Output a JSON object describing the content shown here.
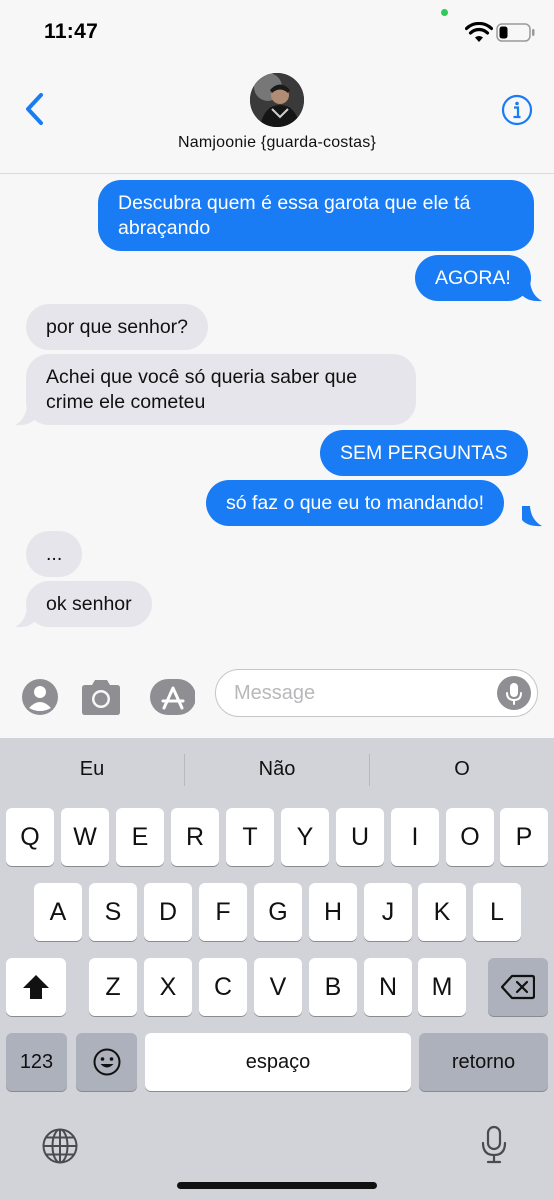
{
  "status_bar": {
    "time": "11:47"
  },
  "header": {
    "contact_name": "Namjoonie {guarda-costas}"
  },
  "messages": [
    {
      "text_lines": [
        "Descubra quem é essa garota que ele tá",
        "abraçando"
      ],
      "from": "me"
    },
    {
      "text_lines": [
        "AGORA!"
      ],
      "from": "me"
    },
    {
      "text_lines": [
        "por que senhor?"
      ],
      "from": "them"
    },
    {
      "text_lines": [
        "Achei que você só queria saber que",
        "crime ele cometeu"
      ],
      "from": "them"
    },
    {
      "text_lines": [
        "SEM PERGUNTAS"
      ],
      "from": "me"
    },
    {
      "text_lines": [
        "só faz o que eu to mandando!"
      ],
      "from": "me"
    },
    {
      "text_lines": [
        "..."
      ],
      "from": "them"
    },
    {
      "text_lines": [
        "ok senhor"
      ],
      "from": "them"
    }
  ],
  "input": {
    "placeholder": "Message"
  },
  "keyboard": {
    "suggestions": [
      "Eu",
      "Não",
      "O"
    ],
    "row1": [
      "Q",
      "W",
      "E",
      "R",
      "T",
      "Y",
      "U",
      "I",
      "O",
      "P"
    ],
    "row2": [
      "A",
      "S",
      "D",
      "F",
      "G",
      "H",
      "J",
      "K",
      "L"
    ],
    "row3": [
      "Z",
      "X",
      "C",
      "V",
      "B",
      "N",
      "M"
    ],
    "numbers_label": "123",
    "space_label": "espaço",
    "return_label": "retorno"
  },
  "colors": {
    "sent_bubble": "#1a7cf5",
    "received_bubble": "#e6e5eb",
    "accent": "#1a7cf5"
  },
  "icons": [
    "back-chevron-icon",
    "info-icon",
    "contact-avatar",
    "wifi-icon",
    "battery-icon",
    "memoji-icon",
    "camera-icon",
    "app-store-icon",
    "microphone-icon",
    "shift-icon",
    "delete-icon",
    "emoji-icon",
    "globe-icon",
    "dictation-icon"
  ]
}
